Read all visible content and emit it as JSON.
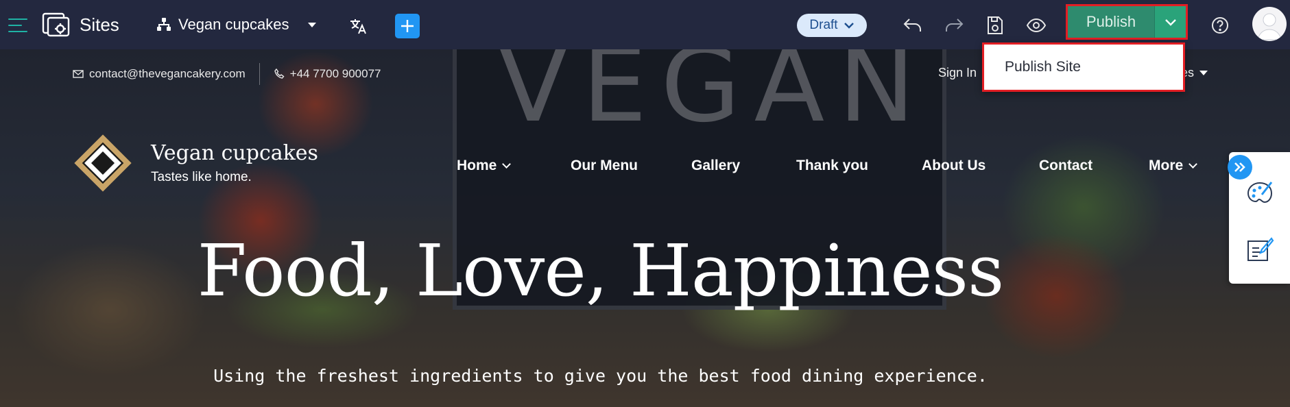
{
  "topbar": {
    "app_name": "Sites",
    "site_name": "Vegan cupcakes",
    "status": "Draft",
    "publish_label": "Publish",
    "colors": {
      "bar": "#23283f",
      "accent": "#1fb3a5",
      "publish": "#2e8b6e",
      "add": "#2196f3"
    },
    "icons": [
      "menu-icon",
      "sites-icon",
      "sitemap-icon",
      "translate-icon",
      "plus-icon",
      "undo-icon",
      "redo-icon",
      "save-icon",
      "preview-eye-icon",
      "chevron-down-icon",
      "help-icon",
      "user-avatar"
    ]
  },
  "dropdown": {
    "items": [
      {
        "label": "Publish Site"
      }
    ]
  },
  "site": {
    "email": "contact@thevegancakery.com",
    "phone": "+44 7700 900077",
    "signin": "Sign In",
    "lang_partial": "es",
    "brand_title": "Vegan cupcakes",
    "brand_tagline": "Tastes like home.",
    "chalk": "VEGAN",
    "nav": [
      {
        "label": "Home",
        "has_submenu": true
      },
      {
        "label": "Our Menu",
        "has_submenu": false
      },
      {
        "label": "Gallery",
        "has_submenu": false
      },
      {
        "label": "Thank you",
        "has_submenu": false
      },
      {
        "label": "About Us",
        "has_submenu": false
      },
      {
        "label": "Contact",
        "has_submenu": false
      },
      {
        "label": "More",
        "has_submenu": true
      }
    ],
    "hero_title": "Food, Love, Happiness",
    "hero_subtitle": "Using the freshest ingredients to give you the best food dining experience."
  },
  "side_panel": {
    "icons": [
      "expand-icon",
      "design-palette-icon",
      "edit-content-icon"
    ]
  }
}
